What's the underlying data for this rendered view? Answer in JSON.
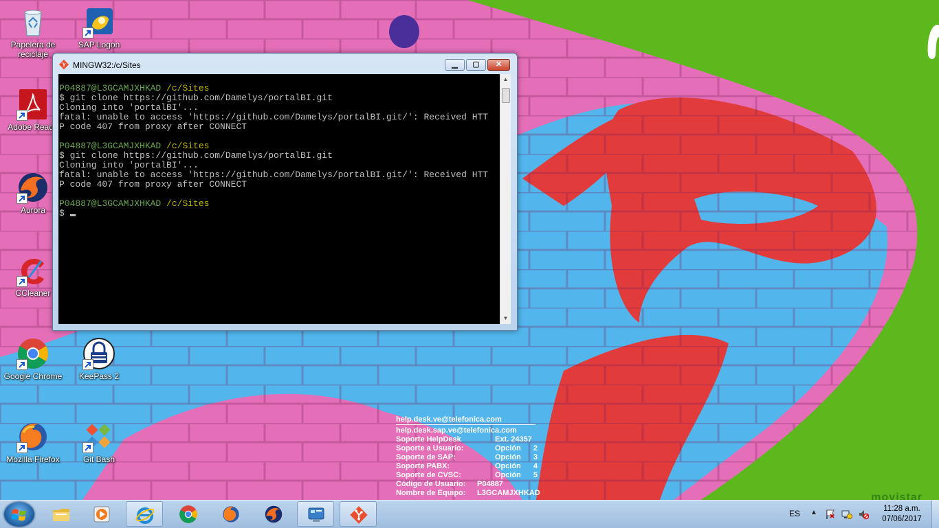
{
  "desktop": {
    "icons": [
      {
        "label": "Papelera de\nreciclaje",
        "icon": "recycle-bin-icon"
      },
      {
        "label": "SAP Logon",
        "icon": "sap-logon-icon"
      },
      {
        "label": "Adobe Reade",
        "icon": "adobe-reader-icon"
      },
      {
        "label": "Aurora",
        "icon": "aurora-icon"
      },
      {
        "label": "CCleaner",
        "icon": "ccleaner-icon"
      },
      {
        "label": "Google Chrome",
        "icon": "chrome-icon"
      },
      {
        "label": "KeePass 2",
        "icon": "keepass-icon"
      },
      {
        "label": "Mozilla Firefox",
        "icon": "firefox-icon"
      },
      {
        "label": "Git Bash",
        "icon": "git-bash-icon"
      }
    ],
    "support_info": {
      "emails": [
        "help.desk.ve@telefonica.com",
        "help.desk.sap.ve@telefonica.com"
      ],
      "rows": [
        {
          "k": "Soporte HelpDesk",
          "v": "Ext. 24357",
          "n": ""
        },
        {
          "k": "Soporte a Usuario:",
          "v": "Opción",
          "n": "2"
        },
        {
          "k": "Soporte de SAP:",
          "v": "Opción",
          "n": "3"
        },
        {
          "k": "Soporte PABX:",
          "v": "Opción",
          "n": "4"
        },
        {
          "k": "Soporte de CVSC:",
          "v": "Opción",
          "n": "5"
        }
      ],
      "user_code_label": "Código de Usuario:",
      "user_code": "P04887",
      "machine_label": "Nombre de Equipo:",
      "machine": "L3GCAMJXHKAD"
    },
    "colors": {
      "brand_green": "#5cb81c",
      "wall_pink": "#e46fb8",
      "paint_blue": "#4fb4ea",
      "paint_red": "#e33a3a"
    }
  },
  "terminal": {
    "title": "MINGW32:/c/Sites",
    "buttons": {
      "minimize": "▁",
      "maximize": "▢",
      "close": "✕"
    },
    "prompt_user": "P04887@L3GCAMJXHKAD",
    "prompt_path": "/c/Sites",
    "lines": [
      "$ git clone https://github.com/Damelys/portalBI.git",
      "Cloning into 'portalBI'...",
      "fatal: unable to access 'https://github.com/Damelys/portalBI.git/': Received HTT",
      "P code 407 from proxy after CONNECT"
    ],
    "last_prompt": "$ "
  },
  "taskbar": {
    "items": [
      "explorer-icon",
      "media-player-icon",
      "internet-explorer-icon",
      "chrome-icon",
      "firefox-icon",
      "aurora-icon",
      "control-panel-icon",
      "git-bash-icon"
    ],
    "language": "ES",
    "tray_arrow": "▲",
    "time": "11:28 a.m.",
    "date": "07/06/2017"
  }
}
